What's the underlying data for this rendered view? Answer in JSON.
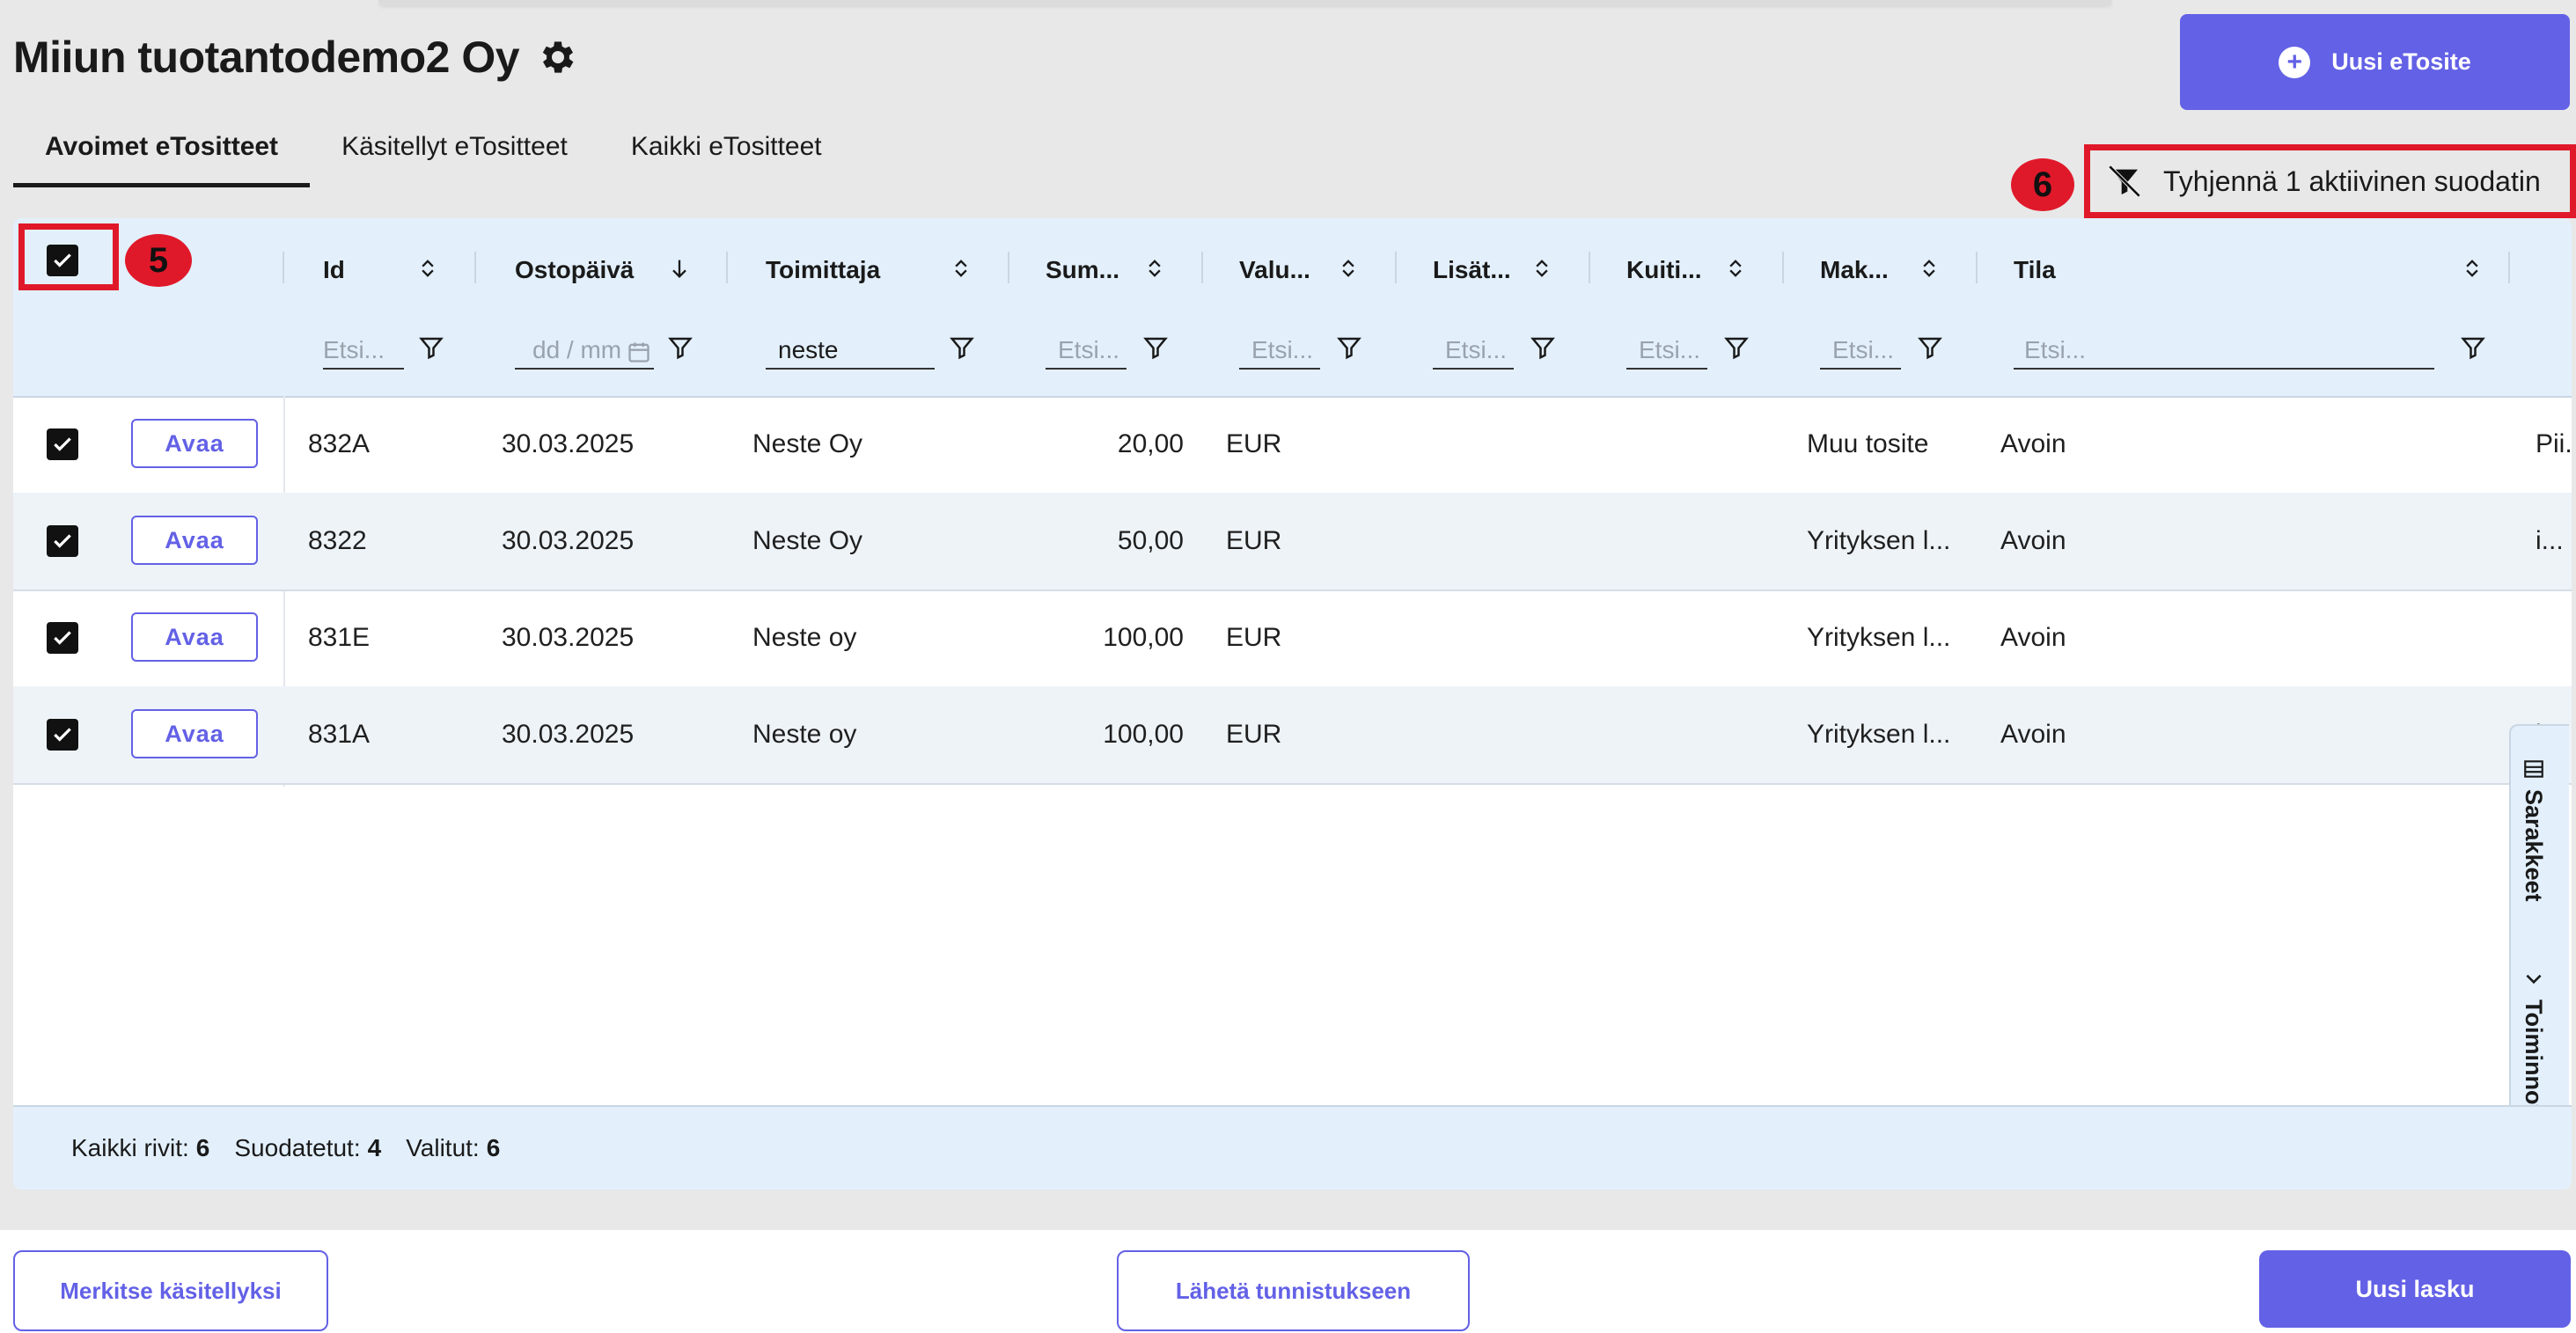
{
  "page": {
    "title": "Miiun tuotantodemo2 Oy"
  },
  "header": {
    "new_button_label": "Uusi eTosite"
  },
  "tabs": [
    {
      "label": "Avoimet eTositteet",
      "active": true
    },
    {
      "label": "Käsitellyt eTositteet",
      "active": false
    },
    {
      "label": "Kaikki eTositteet",
      "active": false
    }
  ],
  "annotations": {
    "a5": "5",
    "a6": "6"
  },
  "clear_filter": {
    "label": "Tyhjennä 1 aktiivinen suodatin"
  },
  "columns": {
    "id": "Id",
    "date": "Ostopäivä",
    "supplier": "Toimittaja",
    "sum": "Sum...",
    "currency": "Valu...",
    "extra": "Lisät...",
    "receipt": "Kuiti...",
    "payment": "Mak...",
    "status": "Tila"
  },
  "filters": {
    "id_placeholder": "Etsi...",
    "date_placeholder": "dd / mm",
    "supplier_value": "neste",
    "sum_placeholder": "Etsi...",
    "currency_placeholder": "Etsi...",
    "extra_placeholder": "Etsi...",
    "receipt_placeholder": "Etsi...",
    "payment_placeholder": "Etsi...",
    "status_placeholder": "Etsi..."
  },
  "row_action_label": "Avaa",
  "rows": [
    {
      "id": "832A",
      "date": "30.03.2025",
      "supplier": "Neste Oy",
      "sum": "20,00",
      "currency": "EUR",
      "payment": "Muu tosite",
      "status": "Avoin",
      "extra": "Pii..."
    },
    {
      "id": "8322",
      "date": "30.03.2025",
      "supplier": "Neste Oy",
      "sum": "50,00",
      "currency": "EUR",
      "payment": "Yrityksen l...",
      "status": "Avoin",
      "extra": "i..."
    },
    {
      "id": "831E",
      "date": "30.03.2025",
      "supplier": "Neste oy",
      "sum": "100,00",
      "currency": "EUR",
      "payment": "Yrityksen l...",
      "status": "Avoin",
      "extra": ""
    },
    {
      "id": "831A",
      "date": "30.03.2025",
      "supplier": "Neste oy",
      "sum": "100,00",
      "currency": "EUR",
      "payment": "Yrityksen l...",
      "status": "Avoin",
      "extra": "i..."
    }
  ],
  "side_panel": {
    "columns_label": "Sarakkeet",
    "actions_label": "Toiminnot"
  },
  "footer": {
    "all_rows_label": "Kaikki rivit:",
    "all_rows": "6",
    "filtered_label": "Suodatetut:",
    "filtered": "4",
    "selected_label": "Valitut:",
    "selected": "6"
  },
  "bottom": {
    "mark_processed": "Merkitse käsitellyksi",
    "send_recognition": "Lähetä tunnistukseen",
    "new_invoice": "Uusi lasku"
  },
  "colors": {
    "accent": "#6361e6",
    "annotation": "#e0192a",
    "grid_header": "#e3f0fc"
  }
}
